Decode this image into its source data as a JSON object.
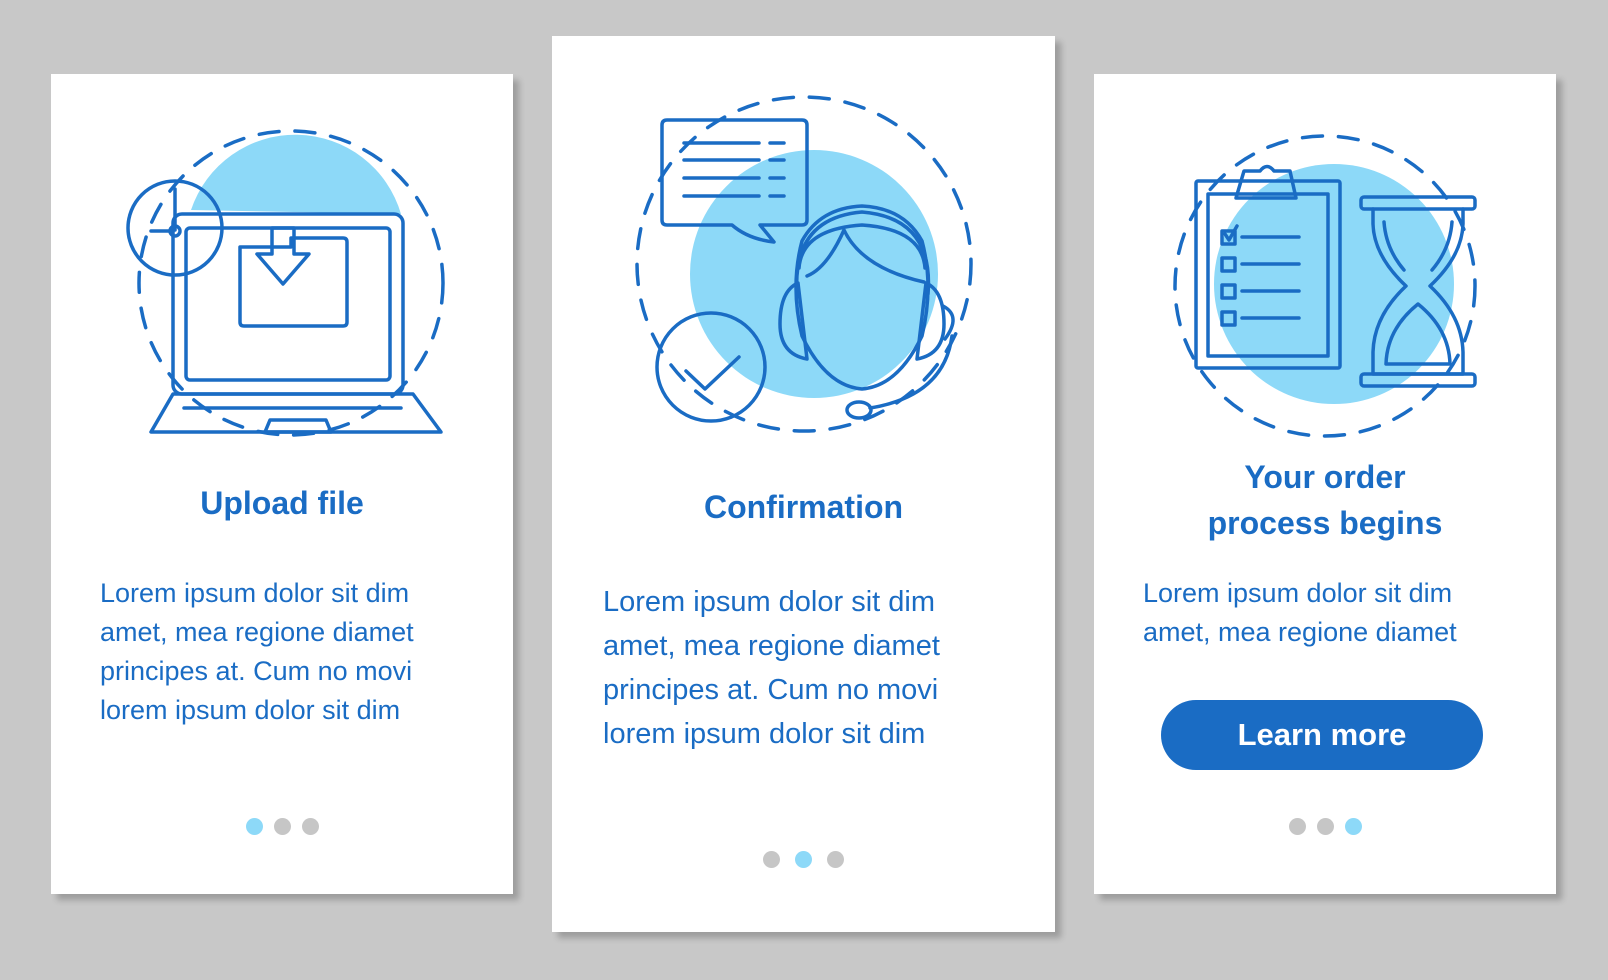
{
  "colors": {
    "background": "#c8c8c8",
    "card": "#ffffff",
    "primary": "#1a6cc4",
    "accent_light": "#8dd9f8",
    "accent_mid": "#5cb3f5",
    "accent_pale": "#c4ecfa",
    "dot_inactive": "#c6c6c6"
  },
  "screens": [
    {
      "illustration": "upload-file-illustration",
      "icons": [
        "laptop-icon",
        "clock-icon",
        "folder-download-icon"
      ],
      "title": "Upload file",
      "body_lines": [
        "Lorem ipsum dolor sit dim",
        "amet, mea regione diamet",
        "principes at. Cum no movi",
        "lorem ipsum dolor sit dim"
      ],
      "page_indicator": {
        "total": 3,
        "active": 1
      }
    },
    {
      "illustration": "confirmation-illustration",
      "icons": [
        "chat-bubble-icon",
        "support-agent-headset-icon",
        "checkmark-circle-icon"
      ],
      "title": "Confirmation",
      "body_lines": [
        "Lorem ipsum dolor sit dim",
        "amet, mea regione diamet",
        "principes at. Cum no movi",
        "lorem ipsum dolor sit dim"
      ],
      "page_indicator": {
        "total": 3,
        "active": 2
      }
    },
    {
      "illustration": "order-process-illustration",
      "icons": [
        "clipboard-checklist-icon",
        "hourglass-icon"
      ],
      "title_lines": [
        "Your order",
        "process begins"
      ],
      "body_lines": [
        "Lorem ipsum dolor sit dim",
        "amet, mea regione diamet"
      ],
      "button_label": "Learn more",
      "page_indicator": {
        "total": 3,
        "active": 3
      }
    }
  ]
}
